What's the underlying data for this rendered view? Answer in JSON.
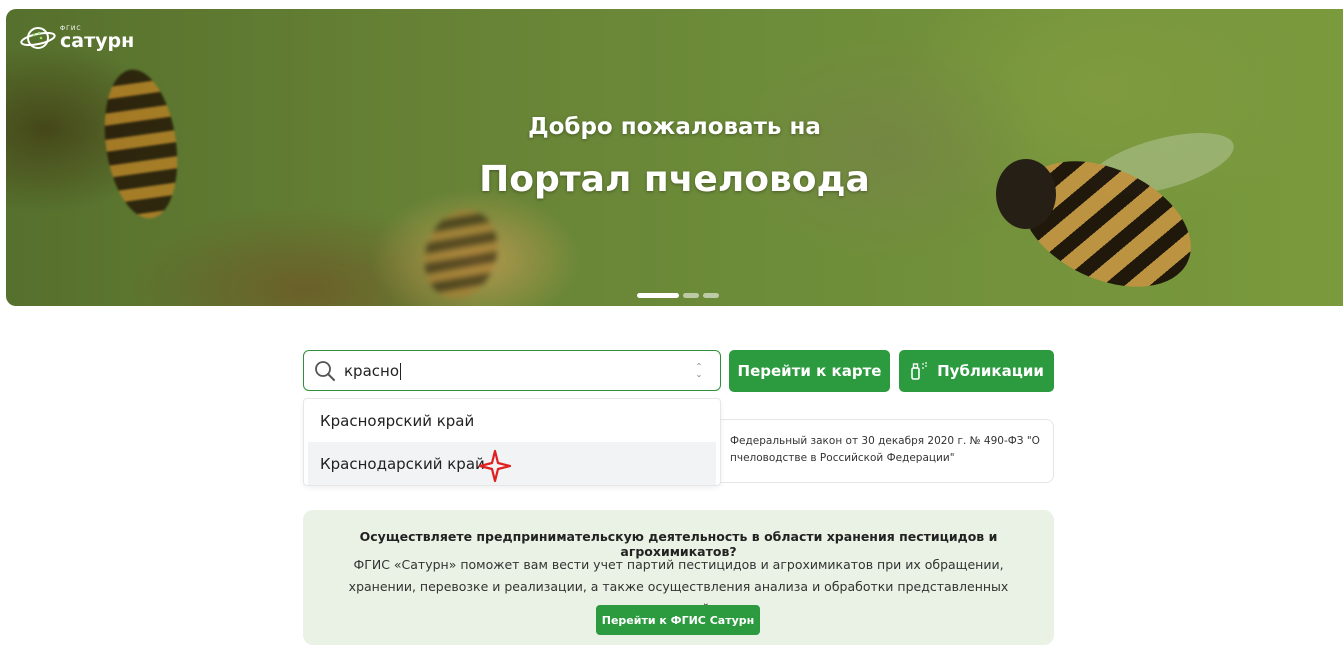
{
  "logo": {
    "small": "ФГИС",
    "big": "сатурн"
  },
  "hero": {
    "subtitle": "Добро пожаловать на",
    "title": "Портал пчеловода",
    "slides": 3,
    "active_slide": 1
  },
  "search": {
    "value": "красно",
    "icon": "search-icon"
  },
  "buttons": {
    "map": "Перейти к карте",
    "publications": "Публикации"
  },
  "dropdown": {
    "items": [
      {
        "label": "Красноярский край"
      },
      {
        "label": "Краснодарский край"
      }
    ],
    "hovered_index": 1
  },
  "news": {
    "text": "Федеральный закон от 30 декабря 2020 г. № 490-ФЗ \"О пчеловодстве в Российской Федерации\""
  },
  "info": {
    "title": "Осуществляете предпринимательскую деятельность в области хранения пестицидов и агрохимикатов?",
    "body": "ФГИС «Сатурн» поможет вам вести учет партий пестицидов и агрохимикатов при их обращении, хранении, перевозке и реализации, а также осуществления анализа и обработки представленных сведений",
    "button": "Перейти к ФГИС Сатурн"
  },
  "colors": {
    "primary_green": "#2c9a3f",
    "info_bg": "#e9f2e4",
    "cursor_red": "#e02020"
  }
}
